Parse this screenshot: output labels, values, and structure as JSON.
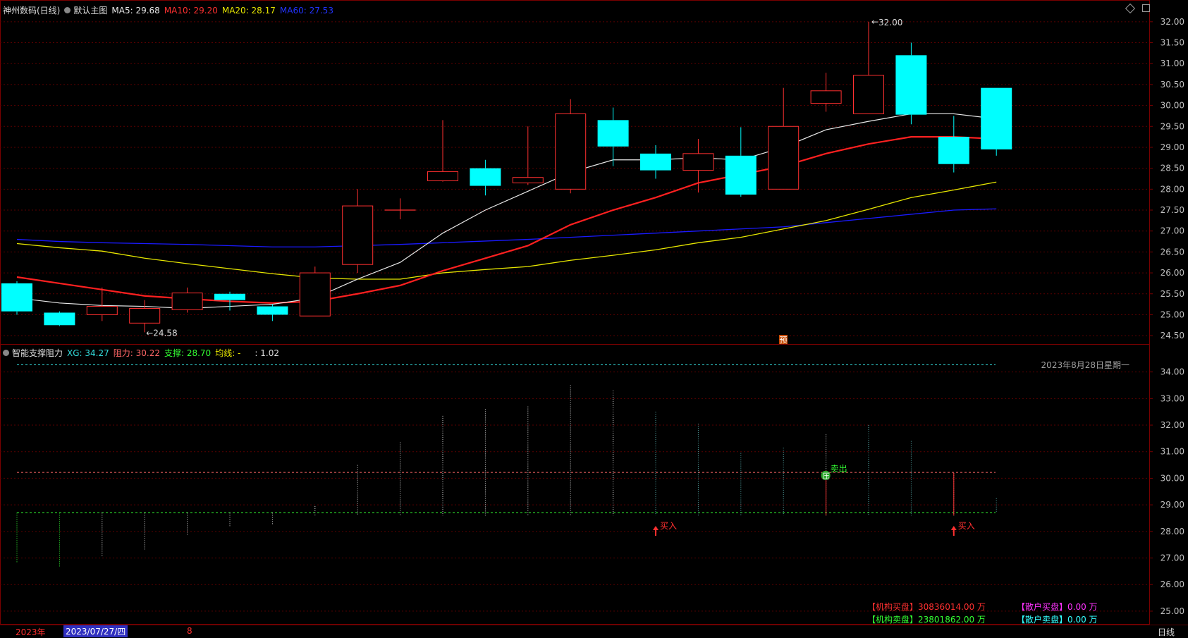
{
  "colors": {
    "up": "#ff3030",
    "down": "#00ffff",
    "ma5": "#e8e8e8",
    "ma10": "#ff2020",
    "ma20": "#e6e600",
    "ma60": "#1a1aff",
    "grid": "#5a0000",
    "axis_text": "#c0c0c0",
    "resistance": "#ff6666",
    "support": "#33ff33",
    "xg": "#33dddd"
  },
  "header": {
    "stock": "神州数码(日线)",
    "template": "默认主图",
    "ma5": "MA5: 29.68",
    "ma10": "MA10: 29.20",
    "ma20": "MA20: 28.17",
    "ma60": "MA60: 27.53"
  },
  "indicator_header": {
    "name": "智能支撑阻力",
    "xg": "XG: 34.27",
    "resist": "阻力: 30.22",
    "support": "支撑: 28.70",
    "avg": "均线: -",
    "extra": ": 1.02"
  },
  "icons": {
    "header_toggle": "circle-toggle-icon",
    "window_controls": "restore-icon"
  },
  "chart_data": [
    {
      "type": "candlestick",
      "ylim": [
        24.3,
        32.25
      ],
      "yticks": [
        "32.00",
        "31.50",
        "31.00",
        "30.50",
        "30.00",
        "29.50",
        "29.00",
        "28.50",
        "28.00",
        "27.50",
        "27.00",
        "26.50",
        "26.00",
        "25.50",
        "25.00",
        "24.50"
      ],
      "candles": [
        {
          "o": 25.75,
          "h": 25.8,
          "l": 25.0,
          "c": 25.08
        },
        {
          "o": 25.05,
          "h": 25.08,
          "l": 24.73,
          "c": 24.75
        },
        {
          "o": 25.0,
          "h": 25.65,
          "l": 24.85,
          "c": 25.2
        },
        {
          "o": 24.8,
          "h": 25.35,
          "l": 24.58,
          "c": 25.15
        },
        {
          "o": 25.12,
          "h": 25.65,
          "l": 25.05,
          "c": 25.52
        },
        {
          "o": 25.5,
          "h": 25.55,
          "l": 25.1,
          "c": 25.35
        },
        {
          "o": 25.2,
          "h": 25.25,
          "l": 24.85,
          "c": 25.0
        },
        {
          "o": 24.97,
          "h": 26.15,
          "l": 24.97,
          "c": 26.0
        },
        {
          "o": 26.2,
          "h": 28.0,
          "l": 26.0,
          "c": 27.6
        },
        {
          "o": 27.5,
          "h": 27.78,
          "l": 27.28,
          "c": 27.5
        },
        {
          "o": 28.2,
          "h": 29.65,
          "l": 28.18,
          "c": 28.42
        },
        {
          "o": 28.5,
          "h": 28.7,
          "l": 27.85,
          "c": 28.08
        },
        {
          "o": 28.15,
          "h": 29.5,
          "l": 28.1,
          "c": 28.28
        },
        {
          "o": 28.0,
          "h": 30.15,
          "l": 27.9,
          "c": 29.8
        },
        {
          "o": 29.65,
          "h": 29.95,
          "l": 28.55,
          "c": 29.02
        },
        {
          "o": 28.85,
          "h": 29.05,
          "l": 28.25,
          "c": 28.45
        },
        {
          "o": 28.45,
          "h": 29.2,
          "l": 27.92,
          "c": 28.85
        },
        {
          "o": 28.8,
          "h": 29.48,
          "l": 27.82,
          "c": 27.87
        },
        {
          "o": 28.0,
          "h": 30.42,
          "l": 28.0,
          "c": 29.5
        },
        {
          "o": 30.05,
          "h": 30.78,
          "l": 29.85,
          "c": 30.35
        },
        {
          "o": 29.8,
          "h": 32.0,
          "l": 29.8,
          "c": 30.72
        },
        {
          "o": 31.2,
          "h": 31.5,
          "l": 29.55,
          "c": 29.78
        },
        {
          "o": 29.25,
          "h": 29.75,
          "l": 28.4,
          "c": 28.6
        },
        {
          "o": 30.42,
          "h": 30.42,
          "l": 28.8,
          "c": 28.95
        }
      ],
      "ma5": [
        25.4,
        25.28,
        25.22,
        25.2,
        25.15,
        25.2,
        25.25,
        25.4,
        25.85,
        26.25,
        26.95,
        27.5,
        27.95,
        28.4,
        28.7,
        28.7,
        28.75,
        28.7,
        29.0,
        29.42,
        29.62,
        29.8,
        29.8,
        29.68
      ],
      "ma10": [
        25.9,
        25.75,
        25.6,
        25.45,
        25.38,
        25.32,
        25.28,
        25.32,
        25.5,
        25.7,
        26.05,
        26.35,
        26.65,
        27.15,
        27.5,
        27.8,
        28.15,
        28.35,
        28.55,
        28.85,
        29.08,
        29.25,
        29.25,
        29.2
      ],
      "ma20": [
        26.7,
        26.6,
        26.52,
        26.35,
        26.22,
        26.1,
        25.98,
        25.88,
        25.85,
        25.85,
        26.0,
        26.08,
        26.15,
        26.3,
        26.42,
        26.55,
        26.72,
        26.85,
        27.05,
        27.25,
        27.52,
        27.8,
        27.98,
        28.17
      ],
      "ma60": [
        26.8,
        26.75,
        26.72,
        26.7,
        26.68,
        26.65,
        26.62,
        26.62,
        26.65,
        26.68,
        26.72,
        26.76,
        26.8,
        26.85,
        26.9,
        26.95,
        27.0,
        27.05,
        27.1,
        27.2,
        27.3,
        27.4,
        27.5,
        27.53
      ],
      "annotations": {
        "high_label": "32.00",
        "low_label": "24.58",
        "forecast_marker": "预"
      }
    },
    {
      "type": "bar",
      "ylim": [
        24.6,
        34.6
      ],
      "yticks": [
        "34.00",
        "33.00",
        "32.00",
        "31.00",
        "30.00",
        "29.00",
        "28.00",
        "27.00",
        "26.00",
        "25.00"
      ],
      "xg_level": 34.27,
      "resistance": 30.22,
      "support": 28.7,
      "bars": [
        {
          "top": 28.7,
          "bottom": 26.8
        },
        {
          "top": 28.7,
          "bottom": 26.65
        },
        {
          "top": 28.7,
          "bottom": 27.05
        },
        {
          "top": 28.7,
          "bottom": 27.3
        },
        {
          "top": 28.7,
          "bottom": 27.85
        },
        {
          "top": 28.7,
          "bottom": 28.2
        },
        {
          "top": 28.7,
          "bottom": 28.25
        },
        {
          "top": 28.95,
          "bottom": 28.6
        },
        {
          "top": 30.5,
          "bottom": 28.6
        },
        {
          "top": 31.35,
          "bottom": 28.6
        },
        {
          "top": 32.35,
          "bottom": 28.6
        },
        {
          "top": 32.6,
          "bottom": 28.6
        },
        {
          "top": 32.7,
          "bottom": 28.6
        },
        {
          "top": 33.5,
          "bottom": 28.6
        },
        {
          "top": 33.3,
          "bottom": 28.6
        },
        {
          "top": 32.5,
          "bottom": 28.6
        },
        {
          "top": 32.05,
          "bottom": 28.6
        },
        {
          "top": 30.95,
          "bottom": 28.6
        },
        {
          "top": 31.15,
          "bottom": 28.6
        },
        {
          "top": 31.65,
          "bottom": 28.6
        },
        {
          "top": 32.0,
          "bottom": 28.6
        },
        {
          "top": 31.4,
          "bottom": 28.6
        },
        {
          "top": 30.2,
          "bottom": 28.6
        },
        {
          "top": 29.25,
          "bottom": 28.7
        }
      ],
      "signals": [
        {
          "index": 15,
          "label": "买入",
          "kind": "buy"
        },
        {
          "index": 19,
          "label": "卖出",
          "kind": "sell",
          "badge": "压"
        },
        {
          "index": 22,
          "label": "买入",
          "kind": "buy"
        }
      ],
      "date_label": "2023年8月28日星期一"
    }
  ],
  "stats": {
    "inst_buy_label": "【机构买盘】",
    "inst_buy_value": "30836014.00 万",
    "inst_sell_label": "【机构卖盘】",
    "inst_sell_value": "23801862.00 万",
    "retail_buy_label": "【散户买盘】",
    "retail_buy_value": "0.00 万",
    "retail_sell_label": "【散户卖盘】",
    "retail_sell_value": "0.00 万"
  },
  "footer": {
    "year": "2023年",
    "cursor_date": "2023/07/27/四",
    "month_mark": "8",
    "period": "日线"
  }
}
